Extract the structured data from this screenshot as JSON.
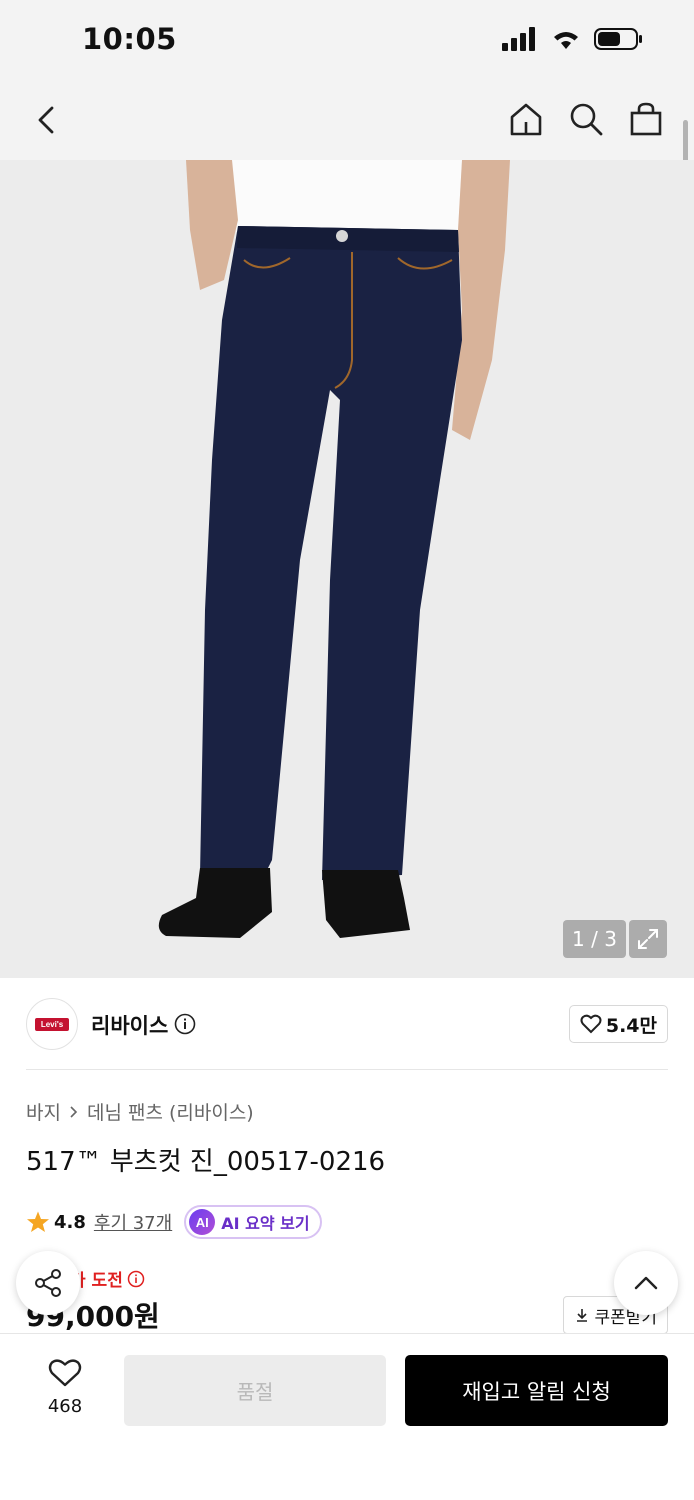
{
  "status_bar": {
    "time": "10:05"
  },
  "nav": {
    "icons": [
      "back-icon",
      "home-icon",
      "search-icon",
      "shopping-bag-icon"
    ]
  },
  "gallery": {
    "counter": "1 / 3"
  },
  "brand": {
    "logo_text": "Levi's",
    "name": "리바이스",
    "likes": "5.4만"
  },
  "breadcrumb": {
    "category": "바지",
    "subcategory": "데님 팬츠 (리바이스)"
  },
  "product": {
    "title": "517™ 부츠컷 진_00517-0216"
  },
  "rating": {
    "score": "4.8",
    "reviews": "후기 37개",
    "ai_badge": "AI",
    "ai_label": "AI 요약 보기"
  },
  "price": {
    "hint": "가 도전",
    "amount": "99,000원",
    "coupon": "쿠폰받기"
  },
  "bottom_bar": {
    "wish_count": "468",
    "soldout_label": "품절",
    "restock_label": "재입고 알림 신청"
  },
  "colors": {
    "accent": "#000000",
    "price_hint": "#e02020",
    "ai_purple": "#6a2fc8",
    "rating_star": "#f5a623"
  }
}
